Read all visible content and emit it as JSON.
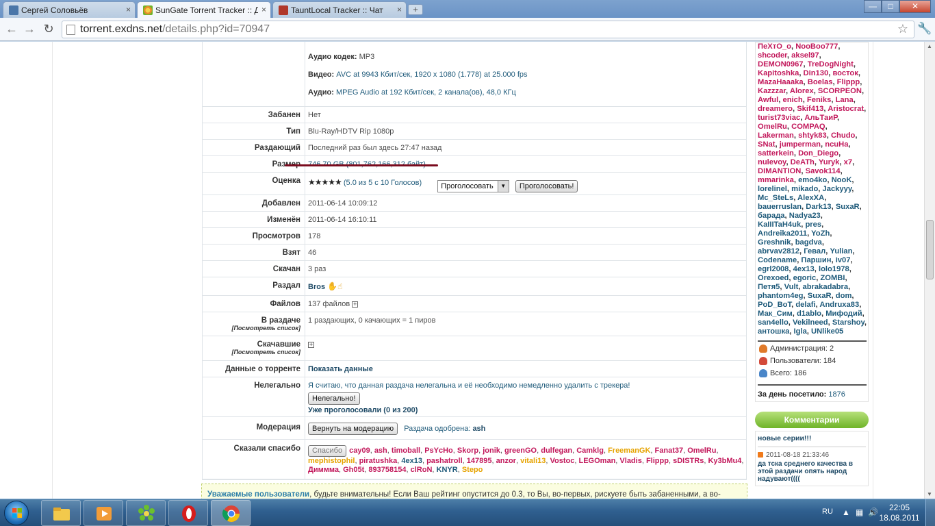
{
  "browser": {
    "tabs": [
      {
        "title": "Сергей Соловьёв",
        "favicon_color": "#4a76a8",
        "active": false
      },
      {
        "title": "SunGate Torrent Tracker :: Д",
        "favicon_color": "#e88a2a",
        "active": true
      },
      {
        "title": "TauntLocal Tracker :: Чат",
        "favicon_color": "#b0382a",
        "active": false
      }
    ],
    "close_glyph": "×",
    "newtab_glyph": "+",
    "url_host": "torrent.exdns.net",
    "url_path": "/details.php?id=70947"
  },
  "details": {
    "audio_codec_label": "Аудио кодек:",
    "audio_codec_value": "MP3",
    "video_label": "Видео:",
    "video_value": "AVC at 9943 Кбит/сек, 1920 x 1080 (1.778) at 25.000 fps",
    "audio_label": "Аудио:",
    "audio_value": "MPEG Audio at 192 Кбит/сек, 2 канала(ов), 48,0 КГц",
    "rows": {
      "banned_label": "Забанен",
      "banned_value": "Нет",
      "type_label": "Тип",
      "type_value": "Blu-Ray/HDTV Rip 1080p",
      "seeder_label": "Раздающий",
      "seeder_value": "Последний раз был здесь 27:47 назад",
      "size_label": "Размер",
      "size_value": "746.70 GB (801,762,166,312 байт)",
      "rating_label": "Оценка",
      "rating_stars": "★★★★★",
      "rating_value": "(5.0 из 5 с 10 Голосов)",
      "vote_select": "Проголосовать",
      "vote_button": "Проголосовать!",
      "added_label": "Добавлен",
      "added_value": "2011-06-14 10:09:12",
      "modified_label": "Изменён",
      "modified_value": "2011-06-14 16:10:11",
      "views_label": "Просмотров",
      "views_value": "178",
      "taken_label": "Взят",
      "taken_value": "46",
      "downloaded_label": "Скачан",
      "downloaded_value": "3 раз",
      "distributed_label": "Раздал",
      "distributed_value": "Bros",
      "files_label": "Файлов",
      "files_value": "137 файлов",
      "seeding_label": "В раздаче",
      "seeding_sub": "[Посмотреть список]",
      "seeding_value": "1 раздающих, 0 качающих = 1 пиров",
      "downloaders_label": "Скачавшие",
      "downloaders_sub": "[Посмотреть список]",
      "torrent_data_label": "Данные о торренте",
      "torrent_data_value": "Показать данные",
      "illegal_label": "Нелегально",
      "illegal_text": "Я считаю, что данная раздача нелегальна и её необходимо немедленно удалить с трекера!",
      "illegal_button": "Нелегально!",
      "illegal_voted": "Уже проголосовали (0 из 200)",
      "moderation_label": "Модерация",
      "moderation_button": "Вернуть на модерацию",
      "moderation_approved": "Раздача одобрена:",
      "moderation_by": "ash",
      "thanks_label": "Сказали спасибо",
      "thanks_button": "Спасибо"
    },
    "thanks_names": [
      {
        "n": "cay09",
        "c": "r"
      },
      {
        "n": "ash",
        "c": "r"
      },
      {
        "n": "timoball",
        "c": "r"
      },
      {
        "n": "PsYcHo",
        "c": "r"
      },
      {
        "n": "Skorp",
        "c": "r"
      },
      {
        "n": "jonik",
        "c": "r"
      },
      {
        "n": "greenGO",
        "c": "r"
      },
      {
        "n": "dulfegan",
        "c": "r"
      },
      {
        "n": "Camklg",
        "c": "r"
      },
      {
        "n": "FreemanGK",
        "c": "o"
      },
      {
        "n": "Fanat37",
        "c": "r"
      },
      {
        "n": "OmelRu",
        "c": "r"
      },
      {
        "n": "mephistophil",
        "c": "o"
      },
      {
        "n": "piratushka",
        "c": "r"
      },
      {
        "n": "4ex13",
        "c": "b"
      },
      {
        "n": "pashatroll",
        "c": "r"
      },
      {
        "n": "147895",
        "c": "r"
      },
      {
        "n": "anzor",
        "c": "r"
      },
      {
        "n": "vitali13",
        "c": "o"
      },
      {
        "n": "Vostoc",
        "c": "r"
      },
      {
        "n": "LEGOman",
        "c": "r"
      },
      {
        "n": "Vladis",
        "c": "r"
      },
      {
        "n": "Flippp",
        "c": "r"
      },
      {
        "n": "sDISTRs",
        "c": "r"
      },
      {
        "n": "Ky3bMu4",
        "c": "r"
      },
      {
        "n": "Диммма",
        "c": "r"
      },
      {
        "n": "Gh05t",
        "c": "r"
      },
      {
        "n": "893758154",
        "c": "r"
      },
      {
        "n": "clRoN",
        "c": "r"
      },
      {
        "n": "KNYR",
        "c": "b"
      },
      {
        "n": "Stepo",
        "c": "o"
      }
    ]
  },
  "notice": {
    "highlight": "Уважаемые пользователи",
    "text": ", будьте внимательны! Если Ваш рейтинг опустится до 0.3, то Вы, во-первых, рискуете быть забаненными, а во-"
  },
  "sidebar": {
    "online_names": [
      {
        "n": "ПеХтО_о",
        "c": "r"
      },
      {
        "n": "NooBoo777",
        "c": "r"
      },
      {
        "n": "shcoder",
        "c": "r"
      },
      {
        "n": "aksel97",
        "c": "r"
      },
      {
        "n": "DEMON0967",
        "c": "r"
      },
      {
        "n": "TreDogNight",
        "c": "r"
      },
      {
        "n": "Kapitoshka",
        "c": "r"
      },
      {
        "n": "Din130",
        "c": "r"
      },
      {
        "n": "восток",
        "c": "r"
      },
      {
        "n": "MazaHaaaka",
        "c": "r"
      },
      {
        "n": "Boelas",
        "c": "r"
      },
      {
        "n": "Flippp",
        "c": "r"
      },
      {
        "n": "Kazzzar",
        "c": "r"
      },
      {
        "n": "Alorex",
        "c": "r"
      },
      {
        "n": "SCORPEON",
        "c": "r"
      },
      {
        "n": "Awful",
        "c": "r"
      },
      {
        "n": "enich",
        "c": "r"
      },
      {
        "n": "Feniks",
        "c": "r"
      },
      {
        "n": "Lana",
        "c": "r"
      },
      {
        "n": "dreamero",
        "c": "r"
      },
      {
        "n": "Skif413",
        "c": "r"
      },
      {
        "n": "Aristocrat",
        "c": "r"
      },
      {
        "n": "turist73viac",
        "c": "r"
      },
      {
        "n": "АльТаиР",
        "c": "r"
      },
      {
        "n": "OmelRu",
        "c": "r"
      },
      {
        "n": "COMPAQ",
        "c": "r"
      },
      {
        "n": "Lakerman",
        "c": "r"
      },
      {
        "n": "shtyk83",
        "c": "r"
      },
      {
        "n": "Chudo",
        "c": "r"
      },
      {
        "n": "SNat",
        "c": "r"
      },
      {
        "n": "jumperman",
        "c": "r"
      },
      {
        "n": "ncuHa",
        "c": "r"
      },
      {
        "n": "satterkein",
        "c": "r"
      },
      {
        "n": "Don_Diego",
        "c": "r"
      },
      {
        "n": "nulevoy",
        "c": "r"
      },
      {
        "n": "DeATh",
        "c": "r"
      },
      {
        "n": "Yuryk",
        "c": "r"
      },
      {
        "n": "x7",
        "c": "r"
      },
      {
        "n": "DIMANTION",
        "c": "r"
      },
      {
        "n": "Savok114",
        "c": "r"
      },
      {
        "n": "mmarinka",
        "c": "r"
      },
      {
        "n": "emo4ko",
        "c": "b"
      },
      {
        "n": "NooK",
        "c": "b"
      },
      {
        "n": "lorelinel",
        "c": "b"
      },
      {
        "n": "mikado",
        "c": "b"
      },
      {
        "n": "Jackyyy",
        "c": "b"
      },
      {
        "n": "Mc_SteLs",
        "c": "b"
      },
      {
        "n": "AlexXA",
        "c": "b"
      },
      {
        "n": "bauerruslan",
        "c": "b"
      },
      {
        "n": "Dark13",
        "c": "b"
      },
      {
        "n": "SuxaR",
        "c": "b"
      },
      {
        "n": "барада",
        "c": "b"
      },
      {
        "n": "Nadya23",
        "c": "b"
      },
      {
        "n": "KaIIITaH4uk",
        "c": "b"
      },
      {
        "n": "pres",
        "c": "b"
      },
      {
        "n": "Andreika2011",
        "c": "b"
      },
      {
        "n": "YoZh",
        "c": "b"
      },
      {
        "n": "Greshnik",
        "c": "b"
      },
      {
        "n": "bagdva",
        "c": "b"
      },
      {
        "n": "abrvav2812",
        "c": "b"
      },
      {
        "n": "Гевал",
        "c": "b"
      },
      {
        "n": "Yulian",
        "c": "b"
      },
      {
        "n": "Codename",
        "c": "b"
      },
      {
        "n": "Паршин",
        "c": "b"
      },
      {
        "n": "iv07",
        "c": "b"
      },
      {
        "n": "egrl2008",
        "c": "b"
      },
      {
        "n": "4ex13",
        "c": "b"
      },
      {
        "n": "lolo1978",
        "c": "b"
      },
      {
        "n": "Orexoed",
        "c": "b"
      },
      {
        "n": "egoric",
        "c": "b"
      },
      {
        "n": "ZOMBI",
        "c": "b"
      },
      {
        "n": "Петя5",
        "c": "b"
      },
      {
        "n": "Vult",
        "c": "b"
      },
      {
        "n": "abrakadabra",
        "c": "b"
      },
      {
        "n": "phantom4eg",
        "c": "b"
      },
      {
        "n": "SuxaR",
        "c": "b"
      },
      {
        "n": "dom",
        "c": "b"
      },
      {
        "n": "PoD_BoT",
        "c": "b"
      },
      {
        "n": "delafi",
        "c": "b"
      },
      {
        "n": "Andruxa83",
        "c": "b"
      },
      {
        "n": "Мак_Сим",
        "c": "b"
      },
      {
        "n": "d1ablo",
        "c": "b"
      },
      {
        "n": "Мифодий",
        "c": "b"
      },
      {
        "n": "san4ello",
        "c": "b"
      },
      {
        "n": "Vekilneed",
        "c": "b"
      },
      {
        "n": "Starshoy",
        "c": "b"
      },
      {
        "n": "антошка",
        "c": "b"
      },
      {
        "n": "Igla",
        "c": "b"
      },
      {
        "n": "UNlike05",
        "c": "b"
      }
    ],
    "admins": "Администрация: 2",
    "users": "Пользователи: 184",
    "total": "Всего: 186",
    "day_visited_label": "За день посетило:",
    "day_visited_value": "1876",
    "comments_header": "Комментарии",
    "comment_title": "новые серии!!!",
    "comment_date": "2011-08-18 21:33:46",
    "comment_text": "да тска среднего качества в этой раздачи опять народ надувают(((("
  },
  "taskbar": {
    "lang": "RU",
    "time": "22:05",
    "date": "18.08.2011"
  },
  "colors": {
    "red_user": "#c2185b",
    "blue_user": "#1e5a7a",
    "orange_user": "#e6a300",
    "accent_green": "#6fb428"
  }
}
